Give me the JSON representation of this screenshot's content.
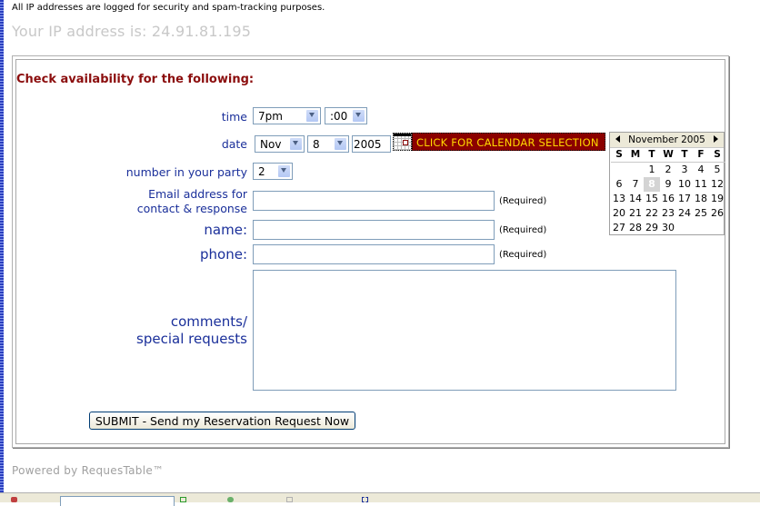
{
  "notice": "All IP addresses are logged for security and spam-tracking purposes.",
  "ip_line": "Your IP address is: 24.91.81.195",
  "form": {
    "heading": "Check availability for the following:",
    "time": {
      "label": "time",
      "hour": "7pm",
      "minute": ":00"
    },
    "date": {
      "label": "date",
      "month": "Nov",
      "day": "8",
      "year": "2005",
      "calendar_button": "CLICK FOR CALENDAR SELECTION"
    },
    "party": {
      "label": "number in your party",
      "value": "2"
    },
    "email": {
      "label_line1": "Email address for",
      "label_line2": "contact & response",
      "value": "",
      "required": "(Required)"
    },
    "name": {
      "label": "name:",
      "value": "",
      "required": "(Required)"
    },
    "phone": {
      "label": "phone:",
      "value": "",
      "required": "(Required)"
    },
    "comments": {
      "label_line1": "comments/",
      "label_line2": "special requests",
      "value": ""
    },
    "submit_label": "SUBMIT - Send my Reservation Request Now"
  },
  "calendar": {
    "month_label": "November 2005",
    "weekdays": [
      "S",
      "M",
      "T",
      "W",
      "T",
      "F",
      "S"
    ],
    "weeks": [
      [
        "",
        "",
        "1",
        "2",
        "3",
        "4",
        "5"
      ],
      [
        "6",
        "7",
        "8",
        "9",
        "10",
        "11",
        "12"
      ],
      [
        "13",
        "14",
        "15",
        "16",
        "17",
        "18",
        "19"
      ],
      [
        "20",
        "21",
        "22",
        "23",
        "24",
        "25",
        "26"
      ],
      [
        "27",
        "28",
        "29",
        "30",
        "",
        "",
        ""
      ]
    ],
    "highlighted_day": "8"
  },
  "footer": "Powered by RequesTable™",
  "colors": {
    "heading": "#8b0d0d",
    "label": "#1a2f9a",
    "calendar_button_bg": "#8b0000",
    "calendar_button_text": "#ffd800"
  }
}
